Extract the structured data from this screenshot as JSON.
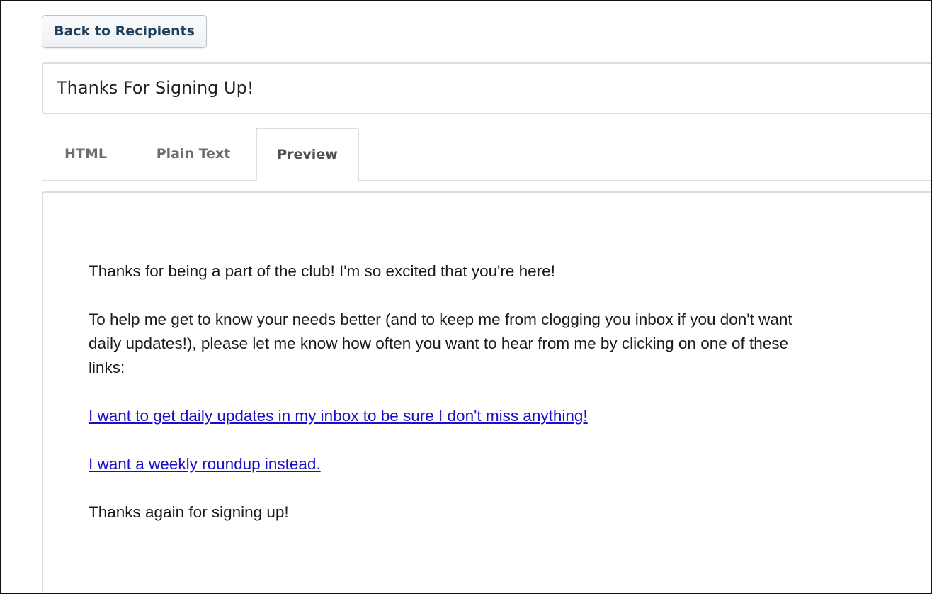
{
  "toolbar": {
    "back_label": "Back to Recipients"
  },
  "subject": {
    "value": "Thanks For Signing Up!"
  },
  "tabs": [
    {
      "label": "HTML"
    },
    {
      "label": "Plain Text"
    },
    {
      "label": "Preview",
      "active": true
    }
  ],
  "preview": {
    "paragraph_1": "Thanks for being a part of the club! I'm so excited that you're here!",
    "paragraph_2": "To help me get to know your needs better (and to keep me from clogging you inbox if you don't want daily updates!), please let me know how often you want to hear from me by clicking on one of these links:",
    "link_daily": "I want to get daily updates in my inbox to be sure I don't miss anything!",
    "link_weekly": "I want a weekly roundup instead. ",
    "closing": "Thanks again for signing up!"
  },
  "colors": {
    "link": "#1a0dcc",
    "button_text": "#1f3f5b",
    "border": "#dcdfe2"
  }
}
